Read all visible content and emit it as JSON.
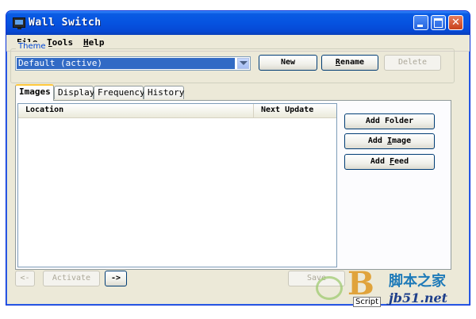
{
  "window": {
    "title": "Wall Switch"
  },
  "menu": {
    "file": "File",
    "file_key": "F",
    "file_rest": "ile",
    "tools": "Tools",
    "tools_key": "T",
    "tools_rest": "ools",
    "help": "Help",
    "help_key": "H",
    "help_rest": "elp"
  },
  "theme": {
    "group_label": "Theme",
    "selected": "Default (active)",
    "buttons": {
      "new": "New",
      "rename_key": "R",
      "rename_rest": "ename",
      "delete": "Delete"
    }
  },
  "tabs": [
    "Images",
    "Display",
    "Frequency",
    "History"
  ],
  "list": {
    "columns": [
      "Location",
      "Next Update"
    ],
    "rows": []
  },
  "side_buttons": {
    "add_folder": "Add Folder",
    "add_image_pre": "Add ",
    "add_image_key": "I",
    "add_image_post": "mage",
    "add_feed_pre": "Add ",
    "add_feed_key": "F",
    "add_feed_post": "eed"
  },
  "bottom": {
    "prev": "<-",
    "activate": "Activate",
    "next": "->",
    "save": "Save"
  },
  "watermark": {
    "script": "Script",
    "cn": "脚本之家",
    "url": "jb51.net"
  },
  "colors": {
    "titlebar": "#0653e0",
    "selection": "#316ac5",
    "tab_accent": "#ffc83c",
    "theme_label": "#0046d5"
  }
}
